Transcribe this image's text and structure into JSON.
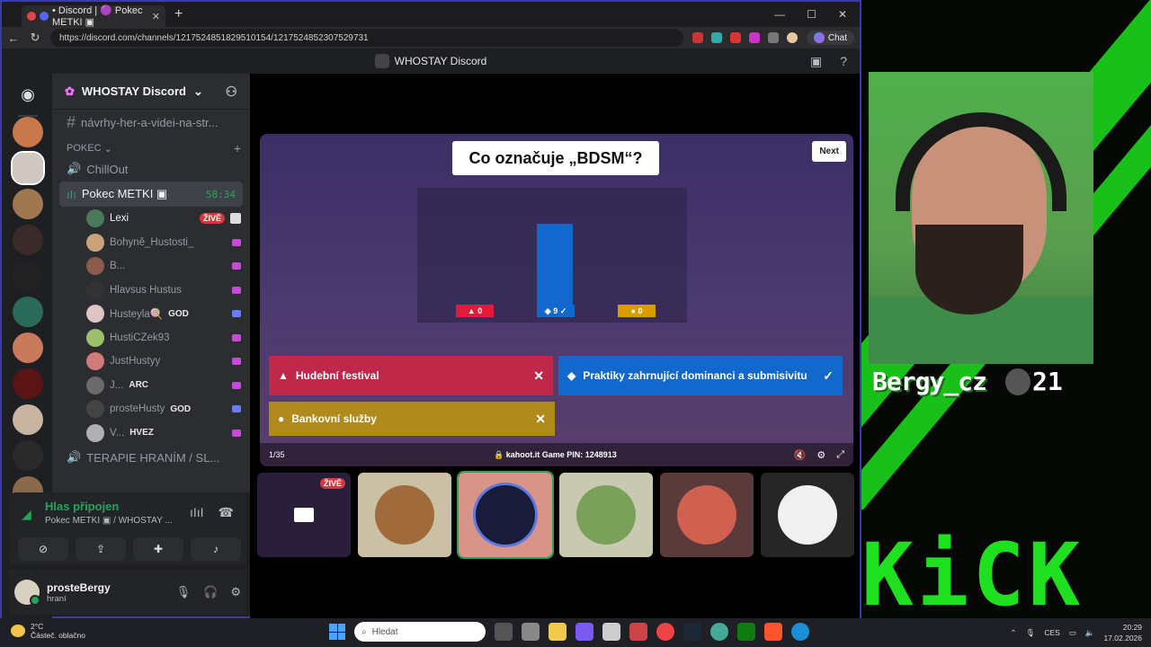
{
  "browser": {
    "tab_title": "• Discord | 🟣 Pokec METKI ▣",
    "url": "https://discord.com/channels/1217524851829510154/1217524852307529731",
    "chat_label": "Chat",
    "window_controls": [
      "—",
      "☐",
      "✕"
    ]
  },
  "discord": {
    "window_title": "WHOSTAY Discord",
    "server_name": "WHOSTAY Discord",
    "text_channel": "návrhy-her-a-videi-na-str...",
    "category": "POKEC",
    "channels": {
      "chillout": "ChillOut",
      "active_voice": "Pokec METKI ▣",
      "active_timer": "58:34",
      "terapie": "TERAPIE HRANÍM / SL..."
    },
    "members": [
      {
        "name": "Lexi",
        "online": true,
        "badge": "ŽIVĚ",
        "color": "#4a7a5a"
      },
      {
        "name": "Bohyně_Hustosti_",
        "online": false,
        "color": "#c9a27a"
      },
      {
        "name": "B...",
        "online": false,
        "color": "#8a5a4a"
      },
      {
        "name": "Hlavsus Hustus",
        "online": false,
        "color": "#333333"
      },
      {
        "name": "Husteyla🍭",
        "online": false,
        "tag": "GOD",
        "color": "#e0c4c4"
      },
      {
        "name": "HustiCZek93",
        "online": false,
        "color": "#9ac06a"
      },
      {
        "name": "JustHustyy",
        "online": false,
        "color": "#d07a7a"
      },
      {
        "name": "J...",
        "online": false,
        "tag": "ARC",
        "color": "#6a6a6a"
      },
      {
        "name": "prosteHusty",
        "online": false,
        "tag": "GOD",
        "color": "#444444"
      },
      {
        "name": "V...",
        "online": false,
        "tag": "HVEZ",
        "color": "#b0b0b0"
      }
    ],
    "voice_panel": {
      "status": "Hlas připojen",
      "channel": "Pokec METKI ▣ / WHOSTAY ..."
    },
    "user": {
      "name": "prosteBergy",
      "status": "hraní"
    }
  },
  "kahoot": {
    "question": "Co označuje „BDSM“?",
    "next_label": "Next",
    "bar_labels": [
      "▲ 0",
      "◆ 9 ✓",
      "● 0"
    ],
    "answers": [
      {
        "text": "Hudební festival",
        "symbol": "▲",
        "mark": "✕",
        "color": "#c0284a"
      },
      {
        "text": "Praktiky zahrnující dominanci a submisivitu",
        "symbol": "◆",
        "mark": "✓",
        "color": "#1368ce"
      },
      {
        "text": "Bankovní služby",
        "symbol": "●",
        "mark": "✕",
        "color": "#b08a1a"
      }
    ],
    "progress": "1/35",
    "pin_info": "🔒 kahoot.it  Game PIN: 1248913"
  },
  "tiles": {
    "live_badge": "ŽIVĚ"
  },
  "stream": {
    "username": "Bergy_cz",
    "count": "21",
    "brand": "KiCK"
  },
  "taskbar": {
    "temp": "2°C",
    "weather": "Částeč. oblačno",
    "search_placeholder": "Hledat",
    "lang": "CES",
    "time": "20:29",
    "date": "17.02.2026"
  },
  "colors": {
    "discord_green": "#23a55a",
    "live_red": "#da373c",
    "kick_green": "#1fe01f",
    "kahoot_blue": "#1368ce"
  }
}
